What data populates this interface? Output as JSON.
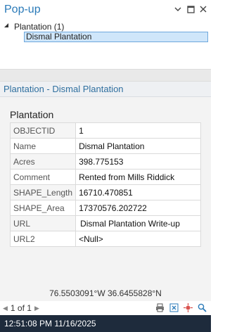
{
  "window": {
    "title": "Pop-up",
    "buttons": {
      "dropdown_icon": "chevron-down-icon",
      "maximize_icon": "maximize-icon",
      "close_icon": "close-icon"
    }
  },
  "tree": {
    "parent_label": "Plantation  (1)",
    "child_label": "Dismal Plantation"
  },
  "popup": {
    "header": "Plantation - Dismal Plantation",
    "section_title": "Plantation",
    "rows": [
      {
        "key": "OBJECTID",
        "value": "1"
      },
      {
        "key": "Name",
        "value": "Dismal Plantation"
      },
      {
        "key": "Acres",
        "value": "398.775153"
      },
      {
        "key": "Comment",
        "value": "Rented from Mills Riddick"
      },
      {
        "key": "SHAPE_Length",
        "value": "16710.470851"
      },
      {
        "key": "SHAPE_Area",
        "value": "17370576.202722"
      },
      {
        "key": "URL",
        "value": "Dismal Plantation Write-up"
      },
      {
        "key": "URL2",
        "value": "<Null>"
      }
    ]
  },
  "coordinates": "76.5503091°W 36.6455828°N",
  "pager": {
    "text": "1 of 1"
  },
  "status": {
    "time": "12:51:08 PM 11/16/2025"
  },
  "colors": {
    "accent": "#2a7ab8",
    "status_bg": "#1e2b3c",
    "selection": "#cfe6fa"
  }
}
